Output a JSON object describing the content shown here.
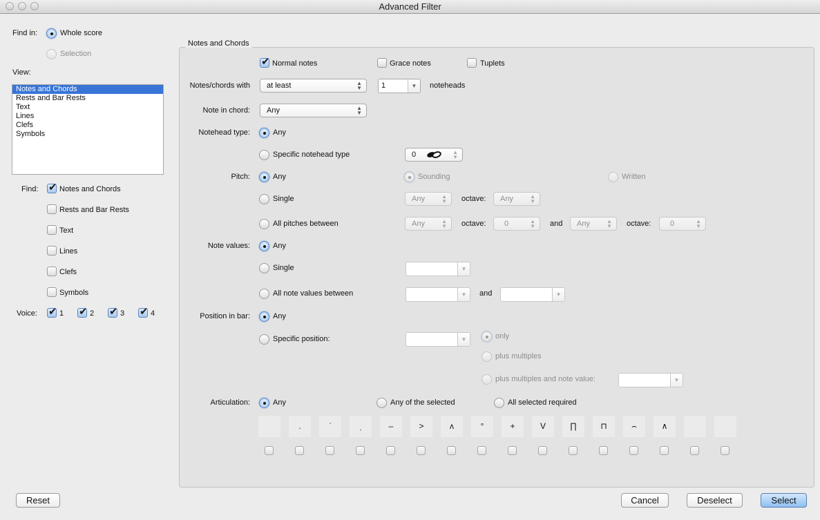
{
  "window": {
    "title": "Advanced Filter"
  },
  "find_in": {
    "label": "Find in:",
    "options": [
      {
        "label": "Whole score",
        "selected": true,
        "enabled": true
      },
      {
        "label": "Selection",
        "selected": false,
        "enabled": false
      }
    ]
  },
  "view": {
    "label": "View:",
    "items": [
      "Notes and Chords",
      "Rests and Bar Rests",
      "Text",
      "Lines",
      "Clefs",
      "Symbols"
    ],
    "selected": "Notes and Chords"
  },
  "find": {
    "label": "Find:",
    "items": [
      {
        "label": "Notes and Chords",
        "checked": true
      },
      {
        "label": "Rests and Bar Rests",
        "checked": false
      },
      {
        "label": "Text",
        "checked": false
      },
      {
        "label": "Lines",
        "checked": false
      },
      {
        "label": "Clefs",
        "checked": false
      },
      {
        "label": "Symbols",
        "checked": false
      }
    ]
  },
  "voice": {
    "label": "Voice:",
    "items": [
      {
        "label": "1",
        "checked": true
      },
      {
        "label": "2",
        "checked": true
      },
      {
        "label": "3",
        "checked": true
      },
      {
        "label": "4",
        "checked": true
      }
    ]
  },
  "panel": {
    "title": "Notes and Chords",
    "note_types": [
      {
        "label": "Normal notes",
        "checked": true
      },
      {
        "label": "Grace notes",
        "checked": false
      },
      {
        "label": "Tuplets",
        "checked": false
      }
    ],
    "notes_chords_with": {
      "label": "Notes/chords with",
      "mode": "at least",
      "count": "1",
      "suffix": "noteheads"
    },
    "note_in_chord": {
      "label": "Note in chord:",
      "value": "Any"
    },
    "notehead_type": {
      "label": "Notehead type:",
      "any_label": "Any",
      "any_selected": true,
      "specific_label": "Specific notehead type",
      "specific_value": "0",
      "specific_icon": "notehead-icon"
    },
    "pitch": {
      "label": "Pitch:",
      "any_label": "Any",
      "any_selected": true,
      "sounding_label": "Sounding",
      "written_label": "Written",
      "single_label": "Single",
      "single_value": "Any",
      "octave_label": "octave:",
      "single_octave": "Any",
      "between_label": "All pitches between",
      "between_from": "Any",
      "between_from_octave": "0",
      "and_label": "and",
      "between_to": "Any",
      "between_to_octave": "0"
    },
    "note_values": {
      "label": "Note values:",
      "any_label": "Any",
      "any_selected": true,
      "single_label": "Single",
      "single_value": "",
      "between_label": "All note values between",
      "between_from": "",
      "and_label": "and",
      "between_to": ""
    },
    "position_in_bar": {
      "label": "Position in bar:",
      "any_label": "Any",
      "any_selected": true,
      "specific_label": "Specific position:",
      "specific_value": "",
      "only_label": "only",
      "plus_multiples_label": "plus multiples",
      "plus_multiples_note_label": "plus multiples and note value:",
      "plus_multiples_note_value": ""
    },
    "articulation": {
      "label": "Articulation:",
      "any_label": "Any",
      "any_selected": true,
      "any_of_selected_label": "Any of the selected",
      "all_required_label": "All selected required",
      "symbols": [
        {
          "name": "blank-icon",
          "glyph": ""
        },
        {
          "name": "staccato-icon",
          "glyph": "."
        },
        {
          "name": "staccatissimo-icon",
          "glyph": "ˈ"
        },
        {
          "name": "wedge-icon",
          "glyph": "ˌ"
        },
        {
          "name": "tenuto-icon",
          "glyph": "–"
        },
        {
          "name": "accent-icon",
          "glyph": ">"
        },
        {
          "name": "marcato-icon",
          "glyph": "ʌ"
        },
        {
          "name": "harmonic-icon",
          "glyph": "°"
        },
        {
          "name": "plus-icon",
          "glyph": "+"
        },
        {
          "name": "up-bow-icon",
          "glyph": "V"
        },
        {
          "name": "down-bow-icon",
          "glyph": "∏"
        },
        {
          "name": "pause-icon",
          "glyph": "⊓"
        },
        {
          "name": "fermata-icon",
          "glyph": "⌢"
        },
        {
          "name": "square-fermata-icon",
          "glyph": "∧"
        },
        {
          "name": "blank-icon",
          "glyph": ""
        },
        {
          "name": "blank-icon",
          "glyph": ""
        }
      ]
    }
  },
  "buttons": {
    "reset": "Reset",
    "cancel": "Cancel",
    "deselect": "Deselect",
    "select": "Select"
  }
}
